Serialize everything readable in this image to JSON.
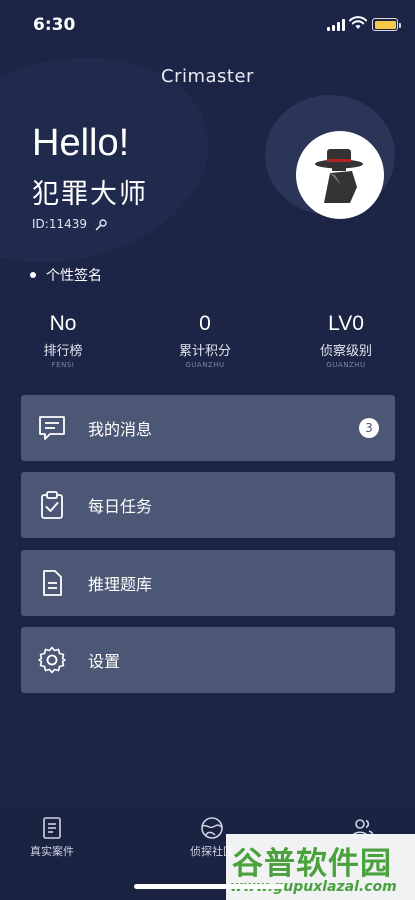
{
  "status_bar": {
    "time": "6:30"
  },
  "header": {
    "title": "Crimaster"
  },
  "profile": {
    "greeting": "Hello!",
    "name": "犯罪大师",
    "id": "ID:11439",
    "signature": "个性签名"
  },
  "stats": [
    {
      "value": "No",
      "label": "排行榜",
      "sub": "FENSI"
    },
    {
      "value": "0",
      "label": "累计积分",
      "sub": "GUANZHU"
    },
    {
      "value": "LV0",
      "label": "侦察级别",
      "sub": "GUANZHU"
    }
  ],
  "menu": [
    {
      "label": "我的消息",
      "icon": "message-icon",
      "badge": "3"
    },
    {
      "label": "每日任务",
      "icon": "task-clipboard-icon"
    },
    {
      "label": "推理题库",
      "icon": "document-icon"
    },
    {
      "label": "设置",
      "icon": "gear-icon"
    }
  ],
  "tabbar": [
    {
      "label": "真实案件",
      "icon": "case-file-icon"
    },
    {
      "label": "侦探社区",
      "icon": "community-globe-icon"
    },
    {
      "label": "",
      "icon": "users-icon"
    }
  ],
  "watermark": {
    "text": "谷普软件园",
    "url": "www.gupuxlazal.com"
  },
  "colors": {
    "background": "#1c2546",
    "menu_card": "#4c5775",
    "battery": "#f4c94a",
    "watermark": "#4aa13e"
  }
}
